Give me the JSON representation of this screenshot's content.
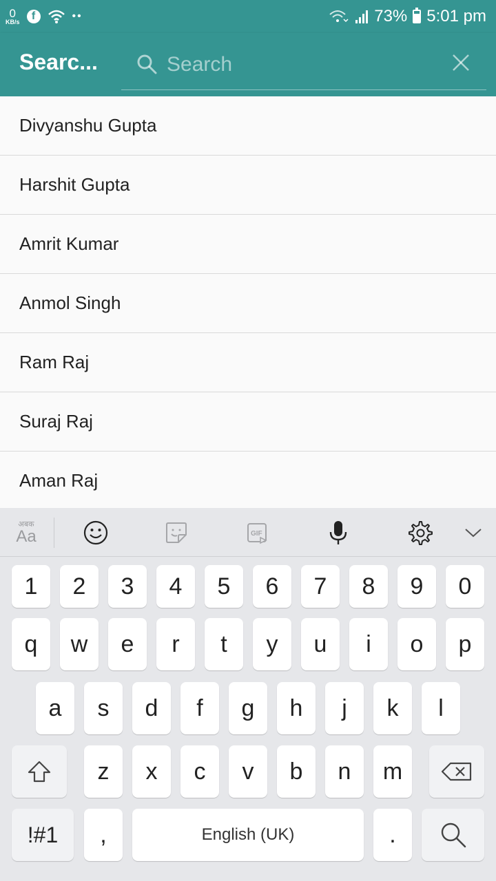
{
  "status_bar": {
    "net_speed_value": "0",
    "net_speed_unit": "KB/s",
    "battery": "73%",
    "battery_level": 0.73,
    "time": "5:01 pm"
  },
  "toolbar": {
    "title": "Searc...",
    "search_placeholder": "Search",
    "accent_color": "#359592"
  },
  "contacts": [
    "Divyanshu Gupta",
    "Harshit Gupta",
    "Amrit Kumar",
    "Anmol Singh",
    "Ram Raj",
    "Suraj Raj",
    "Aman Raj"
  ],
  "keyboard": {
    "row_numbers": [
      "1",
      "2",
      "3",
      "4",
      "5",
      "6",
      "7",
      "8",
      "9",
      "0"
    ],
    "row_1": [
      "q",
      "w",
      "e",
      "r",
      "t",
      "y",
      "u",
      "i",
      "o",
      "p"
    ],
    "row_2": [
      "a",
      "s",
      "d",
      "f",
      "g",
      "h",
      "j",
      "k",
      "l"
    ],
    "row_3": [
      "z",
      "x",
      "c",
      "v",
      "b",
      "n",
      "m"
    ],
    "symbols_key": "!#1",
    "comma_key": ",",
    "space_label": "English (UK)",
    "period_key": ".",
    "font_tool_label": "Aa",
    "font_tool_sub": "अबक",
    "icons": [
      "smiley-icon",
      "sticker-icon",
      "gif-icon",
      "microphone-icon",
      "gear-icon",
      "chevron-down-icon",
      "shift-icon",
      "backspace-icon",
      "search-icon"
    ]
  }
}
